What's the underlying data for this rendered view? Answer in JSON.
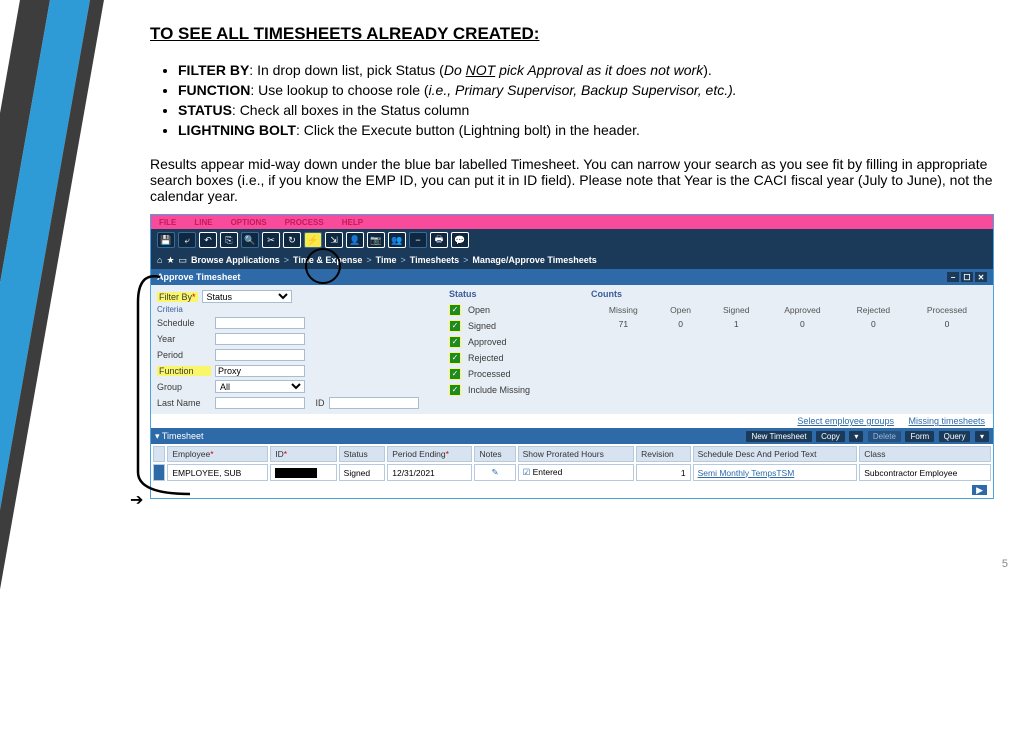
{
  "title": "TO SEE ALL TIMESHEETS ALREADY CREATED:",
  "bullets": [
    {
      "bold": "FILTER BY",
      "rest": ": In drop down list, pick Status (",
      "ital": "Do ",
      "notu": "NOT",
      "ital2": " pick Approval as it does not work",
      "end": ")."
    },
    {
      "bold": "FUNCTION",
      "rest": ": Use lookup to choose role (",
      "ital": "i.e., Primary Supervisor, Backup Supervisor, etc.).",
      "end": ""
    },
    {
      "bold": "STATUS",
      "rest": ": Check all boxes in the Status column",
      "ital": "",
      "end": ""
    },
    {
      "bold": "LIGHTNING BOLT",
      "rest": ": Click the Execute button (Lightning bolt) in the header.",
      "ital": "",
      "end": ""
    }
  ],
  "paragraph": "Results appear mid-way down under the blue bar labelled Timesheet.  You can narrow your search as you see fit by filling in appropriate search boxes (i.e., if you know the EMP ID, you can put it in ID field).  Please note that Year is the CACI fiscal year (July to June), not the calendar year.",
  "menubar": [
    "FILE",
    "LINE",
    "OPTIONS",
    "PROCESS",
    "HELP"
  ],
  "crumb": [
    "Browse Applications",
    ">",
    "Time & Expense",
    ">",
    "Time",
    ">",
    "Timesheets",
    ">",
    "Manage/Approve Timesheets"
  ],
  "approve_title": "Approve Timesheet",
  "criteria": {
    "filterby_label": "Filter By",
    "filterby_value": "Status",
    "other_labels": [
      "Schedule",
      "Year",
      "Period",
      "Function",
      "Group",
      "Last Name"
    ],
    "function_value": "Proxy",
    "group_value": "All",
    "id_label": "ID",
    "criteria_label": "Criteria"
  },
  "status_title": "Status",
  "status_items": [
    "Open",
    "Signed",
    "Approved",
    "Rejected",
    "Processed",
    "Include Missing"
  ],
  "counts": {
    "title": "Counts",
    "headers": [
      "Missing",
      "Open",
      "Signed",
      "Approved",
      "Rejected",
      "Processed"
    ],
    "values": [
      "71",
      "0",
      "1",
      "0",
      "0",
      "0"
    ]
  },
  "links": {
    "sel": "Select employee groups",
    "miss": "Missing timesheets"
  },
  "ts_title": "Timesheet",
  "ts_buttons": [
    "New Timesheet",
    "Copy",
    "▾",
    "Delete",
    "Form",
    "Query",
    "▾"
  ],
  "grid": {
    "headers": [
      "Employee",
      "ID",
      "Status",
      "Period Ending",
      "Notes",
      "Show Prorated Hours",
      "Revision",
      "Schedule Desc And Period Text",
      "Class"
    ],
    "row": {
      "employee": "EMPLOYEE, SUB",
      "status": "Signed",
      "period": "12/31/2021",
      "hours": "Entered",
      "revision": "1",
      "schedule": "Semi Monthly TempsTSM",
      "class": "Subcontractor Employee"
    }
  },
  "pagenum": "5"
}
